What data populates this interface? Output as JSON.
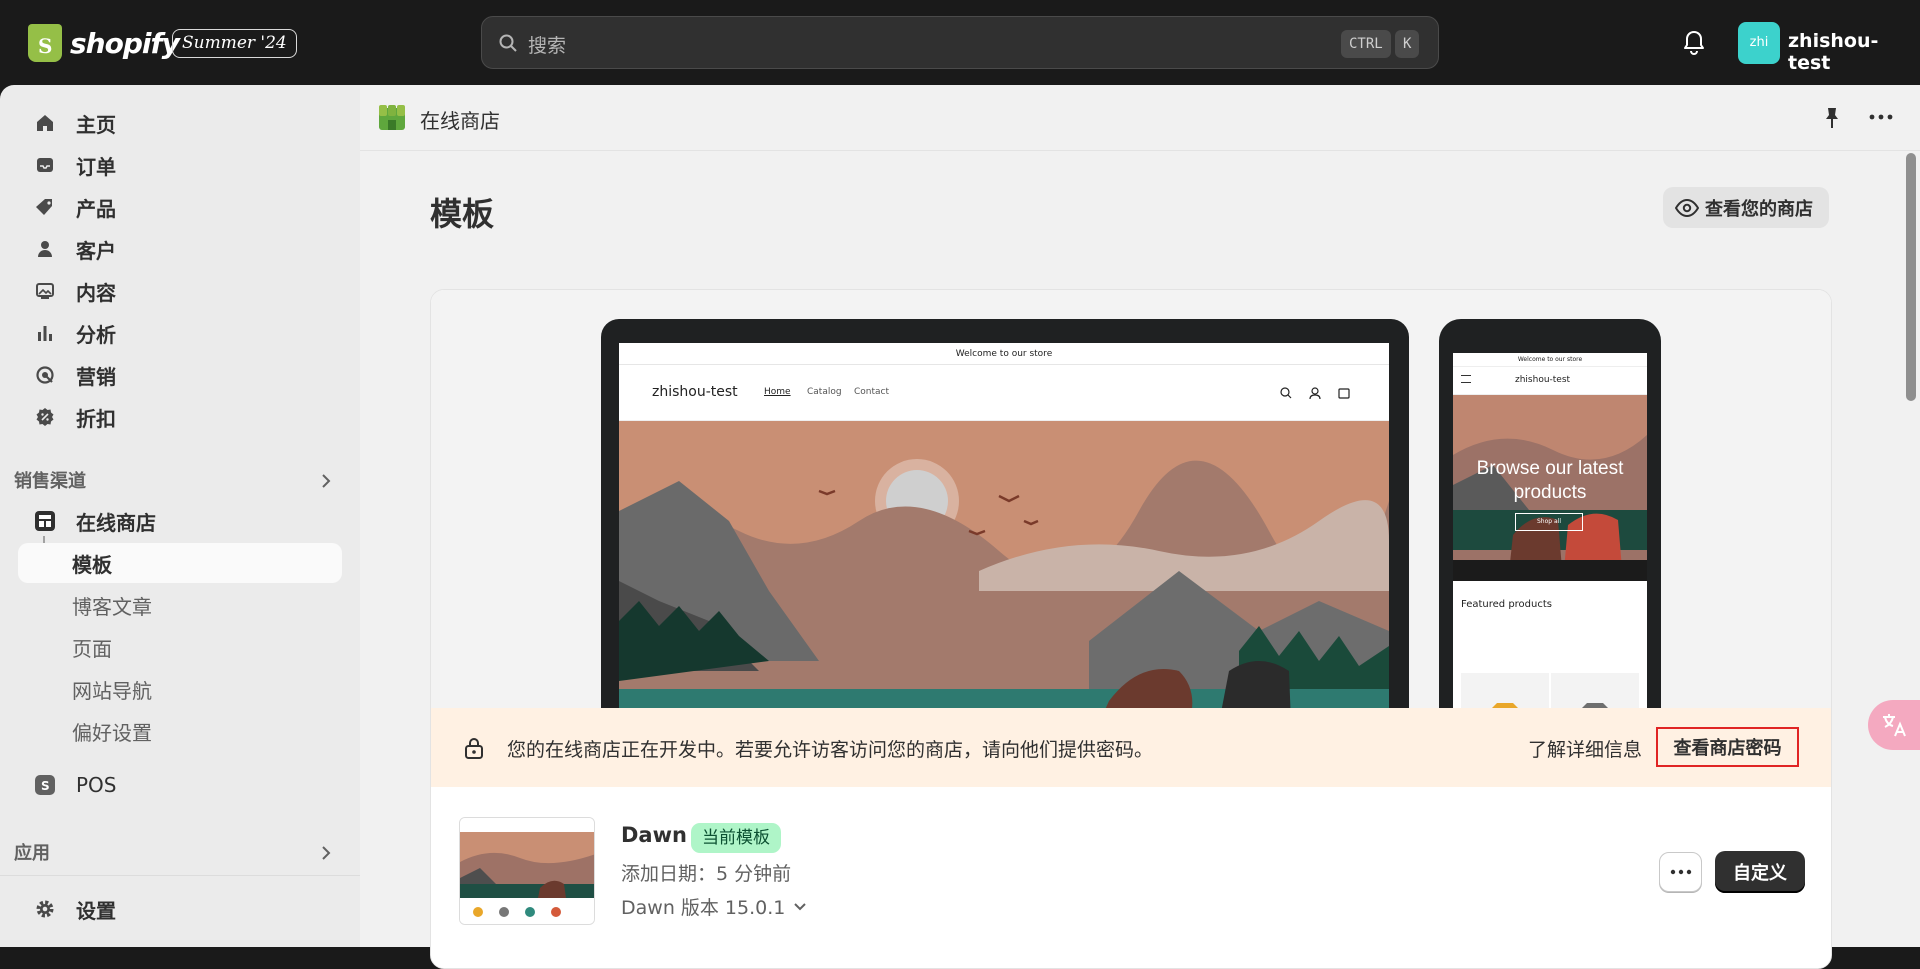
{
  "topbar": {
    "logo_text": "shopify",
    "edition_badge": "Summer '24",
    "search_placeholder": "搜索",
    "shortcut_ctrl": "CTRL",
    "shortcut_k": "K",
    "avatar_initials": "zhi",
    "shop_name": "zhishou-test"
  },
  "sidebar": {
    "items": [
      {
        "label": "主页",
        "icon": "home-icon"
      },
      {
        "label": "订单",
        "icon": "inbox-icon"
      },
      {
        "label": "产品",
        "icon": "tag-icon"
      },
      {
        "label": "客户",
        "icon": "person-icon"
      },
      {
        "label": "内容",
        "icon": "image-icon"
      },
      {
        "label": "分析",
        "icon": "bar-chart-icon"
      },
      {
        "label": "营销",
        "icon": "target-icon"
      },
      {
        "label": "折扣",
        "icon": "discount-icon"
      }
    ],
    "sales_channels_header": "销售渠道",
    "online_store": "在线商店",
    "online_store_sub": [
      "模板",
      "博客文章",
      "页面",
      "网站导航",
      "偏好设置"
    ],
    "pos": "POS",
    "apps_header": "应用",
    "settings": "设置"
  },
  "main": {
    "header_title": "在线商店",
    "page_title": "模板",
    "view_store_button": "查看您的商店",
    "banner": {
      "text": "您的在线商店正在开发中。若要允许访客访问您的商店，请向他们提供密码。",
      "learn_more": "了解详细信息",
      "view_password": "查看商店密码"
    },
    "theme": {
      "name": "Dawn",
      "badge": "当前模板",
      "added": "添加日期：5 分钟前",
      "version": "Dawn 版本 15.0.1",
      "customize_button": "自定义"
    }
  },
  "preview": {
    "announcement": "Welcome to our store",
    "store_name": "zhishou-test",
    "nav": [
      "Home",
      "Catalog",
      "Contact"
    ],
    "mobile_hero": "Browse our latest products",
    "mobile_cta": "Shop all",
    "featured": "Featured products"
  },
  "colors": {
    "accent_green": "#95bf47",
    "banner_bg": "#fff1e3",
    "highlight_red": "#e02424",
    "badge_green": "#aff5c8"
  }
}
